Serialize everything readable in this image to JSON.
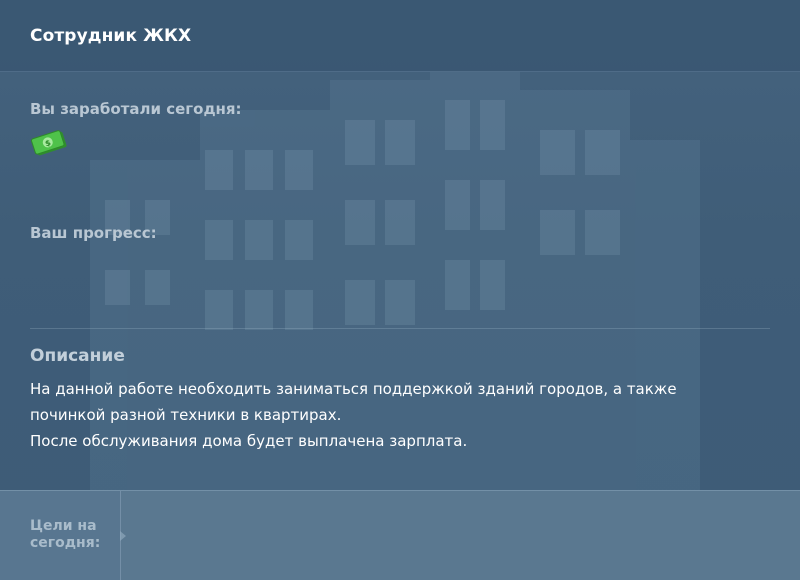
{
  "header": {
    "title": "Сотрудник ЖКХ"
  },
  "earnings": {
    "label": "Вы заработали сегодня:",
    "icon": "money-icon"
  },
  "progress": {
    "label": "Ваш прогресс:"
  },
  "description": {
    "title": "Описание",
    "lines": [
      "На данной работе необходить заниматься поддержкой зданий городов, а также починкой разной техники в квартирах.",
      "После обслуживания дома будет выплачена зарплата."
    ]
  },
  "goals": {
    "label": "Цели на сегодня:"
  },
  "colors": {
    "background": "#3e5d78",
    "footer": "#5a7890",
    "money": "#4fc24a"
  }
}
